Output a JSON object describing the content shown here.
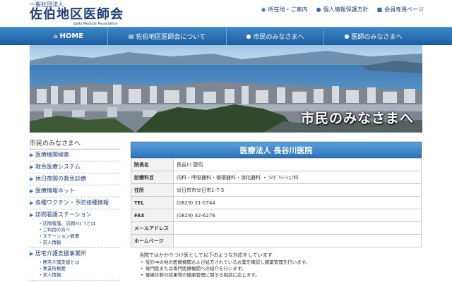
{
  "header": {
    "org_type": "一般社団法人",
    "name": "佐伯地区医師会",
    "name_en": "Saiki Medical Association",
    "links": [
      {
        "label": "所在地・ご案内"
      },
      {
        "label": "個人情報保護方針"
      },
      {
        "label": "会員専用ページ"
      }
    ]
  },
  "nav": {
    "home": "HOME",
    "about": "佐伯地区医師会について",
    "citizen": "市民のみなさまへ",
    "doctor": "医師のみなさまへ"
  },
  "hero": {
    "caption": "市民のみなさまへ"
  },
  "sidebar": {
    "title": "市民のみなさまへ",
    "items": [
      {
        "label": "医療機関検索"
      },
      {
        "label": "救急医療システム"
      },
      {
        "label": "休日夜間の救急診療"
      },
      {
        "label": "医療情報ネット"
      },
      {
        "label": "各種ワクチン・予防接種情報"
      }
    ],
    "group1": {
      "label": "訪問看護ステーション",
      "subs": [
        "・訪問看護、訪問ﾘﾊﾋﾞﾘとは",
        "・ご利用の方へ",
        "・ステーション概要",
        "・求人情報"
      ]
    },
    "group2": {
      "label": "居宅介護支援事業所",
      "subs": [
        "・居宅介護支援とは",
        "・事業所概要",
        "・求人情報"
      ]
    }
  },
  "main": {
    "title": "医療法人 長谷川医院",
    "rows": [
      {
        "key": "院長名",
        "value": "長谷川 健司"
      },
      {
        "key": "診療科目",
        "value": "内科・呼吸器科・循環器科・消化器科 ・ ﾘﾊﾋﾞﾘﾃｰｼｮﾝ科"
      },
      {
        "key": "住所",
        "value": "廿日市市廿日市1-7-5"
      },
      {
        "key": "TEL",
        "value": "(0829) 31-0744"
      },
      {
        "key": "FAX",
        "value": "(0829) 32-6276"
      },
      {
        "key": "メールアドレス",
        "value": ""
      },
      {
        "key": "ホームページ",
        "value": ""
      }
    ],
    "description": "当院ではかかりつけ医として以下のような対応をしています",
    "bullets": [
      "受診中の他の医療機関および処方されているお薬を確認し服薬管理を行います。",
      "専門医または専門医療機関への紹介を行います。",
      "健康診断の結果等の健康管理に関する相談に応じます。"
    ]
  }
}
